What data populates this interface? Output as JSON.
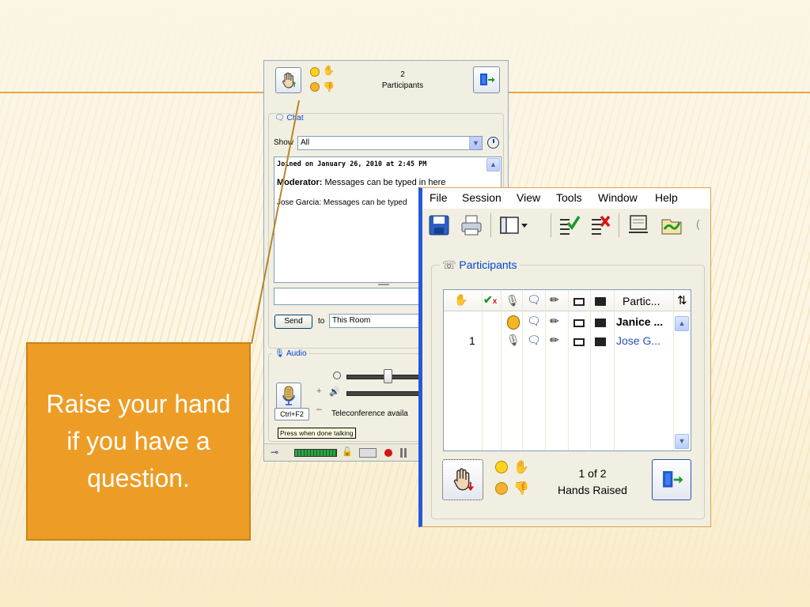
{
  "back_window": {
    "participants_count": "2",
    "participants_label": "Participants",
    "chat": {
      "section_title": "Chat",
      "show_label": "Show",
      "show_value": "All",
      "log": {
        "joined": "Joined on January 26, 2010 at 2:45 PM",
        "moderator_name": "Moderator:",
        "moderator_msg": " Messages can be typed in here",
        "jose_line": "Jose Garcia: Messages can be typed"
      },
      "send_label": "Send",
      "to_label": "to",
      "to_value": "This Room"
    },
    "audio": {
      "section_title": "Audio",
      "talk_shortcut": "Ctrl+F2",
      "teleconf_text": "Teleconference availa",
      "tooltip": "Press when done talking"
    }
  },
  "front_window": {
    "menu": [
      "File",
      "Session",
      "View",
      "Tools",
      "Window",
      "Help"
    ],
    "participants_title": "Participants",
    "column_header_name": "Partic...",
    "rows": [
      {
        "hand": "",
        "name": "Janice ..."
      },
      {
        "hand": "1",
        "name": "Jose G..."
      }
    ],
    "hands_raised_count": "1 of 2",
    "hands_raised_label": "Hands Raised"
  },
  "callout": {
    "text": "Raise your hand if you have a question."
  },
  "colors": {
    "callout_fill": "#ed9d26",
    "accent_rule": "#e8a54a",
    "window_blue": "#2759d6",
    "link_blue": "#0046d5"
  }
}
